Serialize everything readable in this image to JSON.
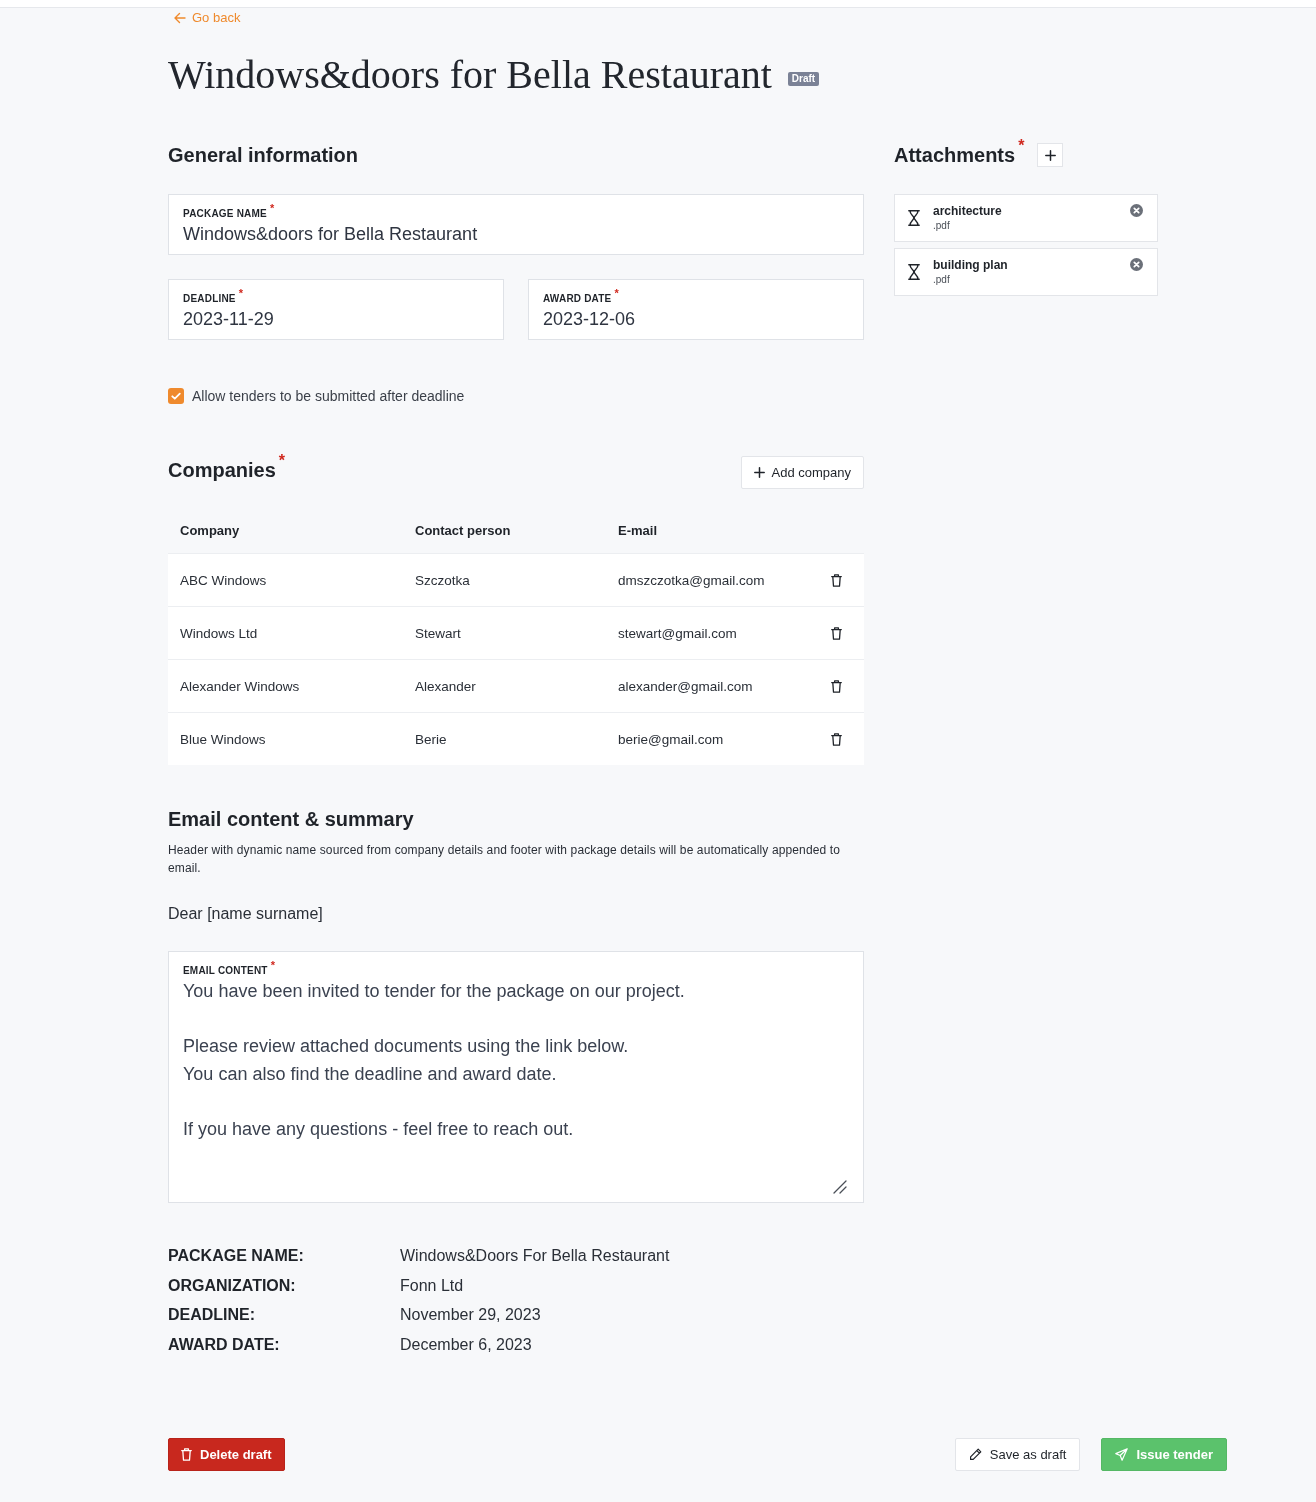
{
  "top_link": {
    "label": "Go back"
  },
  "header": {
    "title": "Windows&doors for Bella Restaurant",
    "badge": "Draft"
  },
  "general_information": {
    "heading": "General information",
    "fields": [
      {
        "label": "PACKAGE NAME",
        "required_mark": "*",
        "value": "Windows&doors for Bella Restaurant"
      },
      {
        "label": "DEADLINE",
        "required_mark": "*",
        "value": "2023-11-29"
      },
      {
        "label": "AWARD DATE",
        "required_mark": "*",
        "value": "2023-12-06"
      }
    ],
    "late_submission": {
      "label": "Allow tenders to be submitted after deadline",
      "checked": true
    }
  },
  "companies": {
    "heading": "Companies",
    "required_mark": "*",
    "add_button": "Add company",
    "columns": [
      "Company",
      "Contact person",
      "E-mail"
    ],
    "rows": [
      {
        "company": "ABC Windows",
        "contact_person": "Szczotka",
        "email": "dmszczotka@gmail.com"
      },
      {
        "company": "Windows Ltd",
        "contact_person": "Stewart",
        "email": "stewart@gmail.com"
      },
      {
        "company": "Alexander Windows",
        "contact_person": "Alexander",
        "email": "alexander@gmail.com"
      },
      {
        "company": "Blue Windows",
        "contact_person": "Berie",
        "email": "berie@gmail.com"
      }
    ]
  },
  "email": {
    "heading": "Email content & summary",
    "description": "Header with dynamic name sourced from company details and footer with package details will be automatically appended to email.",
    "greeting": "Dear [name surname]",
    "content": {
      "label": "EMAIL CONTENT",
      "required_mark": "*",
      "value": "You have been invited to tender for the package on our project.\n\nPlease review attached documents using the link below.\nYou can also find the deadline and award date.\n\nIf you have any questions - feel free to reach out."
    }
  },
  "summary": [
    {
      "label": "PACKAGE NAME:",
      "value": "Windows&Doors For Bella Restaurant"
    },
    {
      "label": "ORGANIZATION:",
      "value": "Fonn Ltd"
    },
    {
      "label": "DEADLINE:",
      "value": "November 29, 2023"
    },
    {
      "label": "AWARD DATE:",
      "value": "December 6, 2023"
    }
  ],
  "attachments": {
    "heading": "Attachments",
    "required_mark": "*",
    "files": [
      {
        "name": "architecture",
        "extension": ".pdf"
      },
      {
        "name": "building plan",
        "extension": ".pdf"
      }
    ]
  },
  "actions": [
    {
      "kind": "delete",
      "label": "Delete draft"
    },
    {
      "kind": "save",
      "label": "Save as draft"
    },
    {
      "kind": "issue",
      "label": "Issue tender"
    }
  ]
}
